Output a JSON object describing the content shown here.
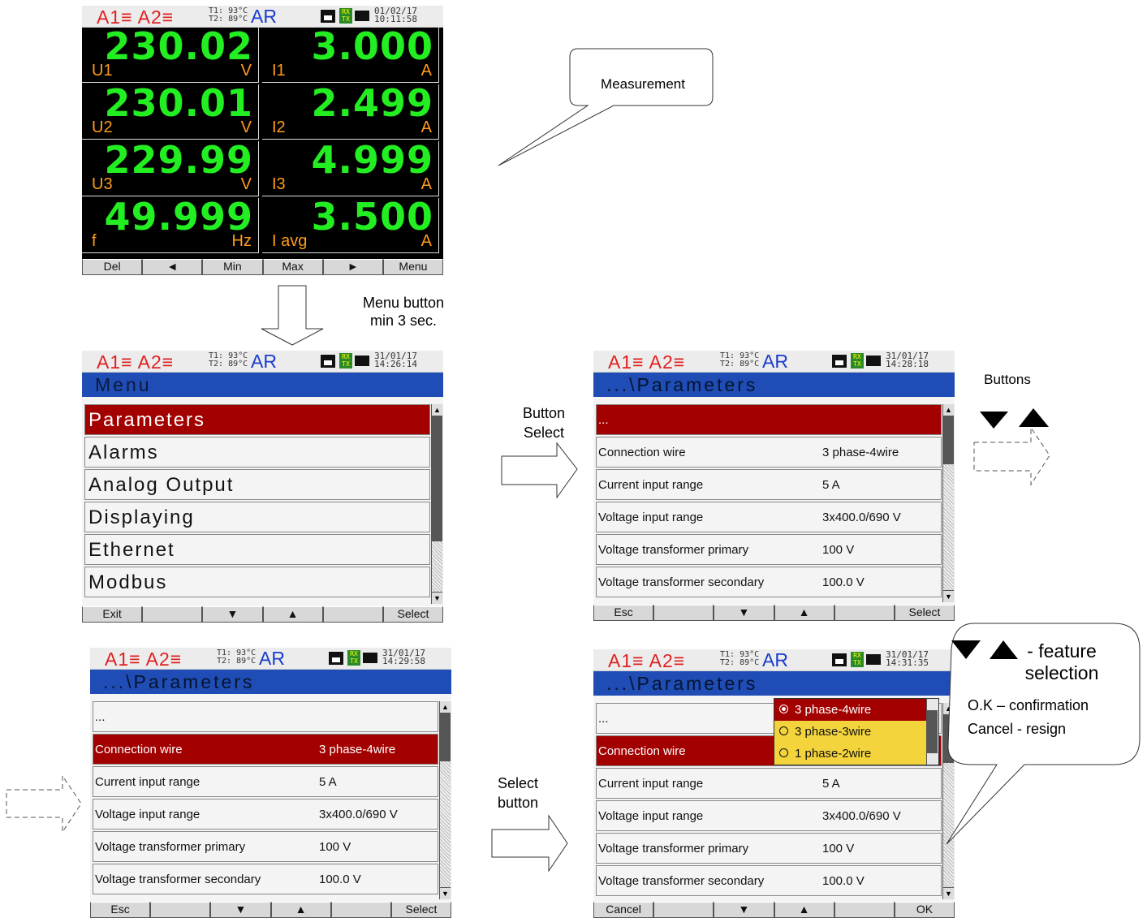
{
  "measurement_screen": {
    "header": {
      "alarms": "A1≡ A2≡",
      "temps": [
        "T1: 93°C",
        "T2: 89°C"
      ],
      "ar": "AR",
      "rx": "RX",
      "tx": "TX",
      "date": "01/02/17",
      "time": "10:11:58"
    },
    "cells": [
      {
        "value": "230.02",
        "name": "U1",
        "unit": "V"
      },
      {
        "value": "3.000",
        "name": "I1",
        "unit": "A"
      },
      {
        "value": "230.01",
        "name": "U2",
        "unit": "V"
      },
      {
        "value": "2.499",
        "name": "I2",
        "unit": "A"
      },
      {
        "value": "229.99",
        "name": "U3",
        "unit": "V"
      },
      {
        "value": "4.999",
        "name": "I3",
        "unit": "A"
      },
      {
        "value": "49.999",
        "name": "f",
        "unit": "Hz"
      },
      {
        "value": "3.500",
        "name": "I avg",
        "unit": "A"
      }
    ],
    "buttons": [
      "Del",
      "◄",
      "Min",
      "Max",
      "►",
      "Menu"
    ]
  },
  "menu_screen": {
    "header": {
      "alarms": "A1≡ A2≡",
      "temps": [
        "T1: 93°C",
        "T2: 89°C"
      ],
      "ar": "AR",
      "rx": "RX",
      "tx": "TX",
      "date": "31/01/17",
      "time": "14:26:14"
    },
    "title": "Menu",
    "items": [
      "Parameters",
      "Alarms",
      "Analog Output",
      "Displaying",
      "Ethernet",
      "Modbus"
    ],
    "buttons": [
      "Exit",
      "",
      "▼",
      "▲",
      "",
      "Select"
    ]
  },
  "params_screen_1": {
    "header": {
      "alarms": "A1≡ A2≡",
      "temps": [
        "T1: 93°C",
        "T2: 89°C"
      ],
      "ar": "AR",
      "rx": "RX",
      "tx": "TX",
      "date": "31/01/17",
      "time": "14:28:18"
    },
    "title": "...\\Parameters",
    "buttons": [
      "Esc",
      "",
      "▼",
      "▲",
      "",
      "Select"
    ]
  },
  "params_screen_2": {
    "header": {
      "alarms": "A1≡ A2≡",
      "temps": [
        "T1: 93°C",
        "T2: 89°C"
      ],
      "ar": "AR",
      "rx": "RX",
      "tx": "TX",
      "date": "31/01/17",
      "time": "14:29:58"
    },
    "title": "...\\Parameters",
    "buttons": [
      "Esc",
      "",
      "▼",
      "▲",
      "",
      "Select"
    ]
  },
  "params_screen_3": {
    "header": {
      "alarms": "A1≡ A2≡",
      "temps": [
        "T1: 93°C",
        "T2: 89°C"
      ],
      "ar": "AR",
      "rx": "RX",
      "tx": "TX",
      "date": "31/01/17",
      "time": "14:31:35"
    },
    "title": "...\\Parameters",
    "dropdown": [
      "3 phase-4wire",
      "3 phase-3wire",
      "1 phase-2wire"
    ],
    "buttons": [
      "Cancel",
      "",
      "▼",
      "▲",
      "",
      "OK"
    ]
  },
  "params": [
    {
      "label": "...",
      "value": ""
    },
    {
      "label": "Connection wire",
      "value": "3 phase-4wire"
    },
    {
      "label": "Current input range",
      "value": "5 A"
    },
    {
      "label": "Voltage input range",
      "value": "3x400.0/690 V"
    },
    {
      "label": "Voltage transformer primary",
      "value": "100 V"
    },
    {
      "label": "Voltage transformer secondary",
      "value": "100.0 V"
    }
  ],
  "annotations": {
    "measurement": "Measurement",
    "menu_button": [
      "Menu button",
      "min 3 sec."
    ],
    "button_select": [
      "Button",
      "Select"
    ],
    "buttons": "Buttons",
    "select_button": [
      "Select",
      "button"
    ],
    "feature_selection": [
      "- feature",
      "selection"
    ],
    "ok": "O.K – confirmation",
    "cancel": "Cancel - resign"
  }
}
